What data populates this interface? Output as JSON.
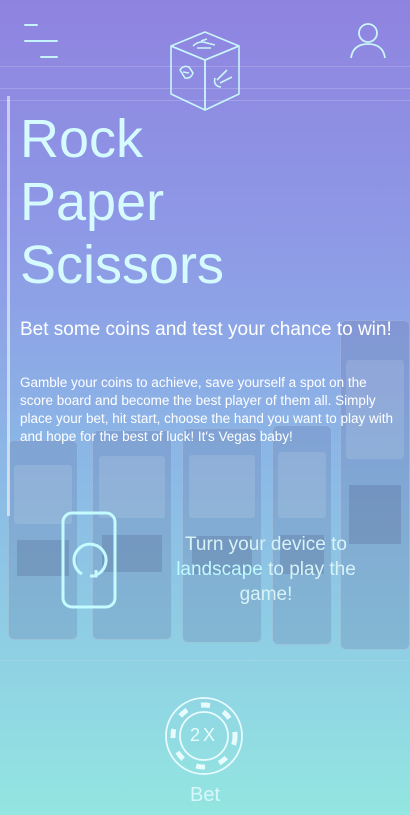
{
  "header": {
    "menu_icon": "hamburger-menu-icon",
    "logo_icon": "rps-dice-logo-icon",
    "user_icon": "user-profile-icon"
  },
  "hero": {
    "title_line1": "Rock",
    "title_line2": "Paper",
    "title_line3": "Scissors",
    "subtitle": "Bet some coins and test your chance to win!",
    "description": "Gamble your coins to achieve, save yourself a spot on the score board and become the best player of them all. Simply place your bet, hit start, choose the hand you want to play with and hope for the best of luck! It's Vegas baby!"
  },
  "rotate_notice": {
    "icon": "rotate-device-icon",
    "text_before": "Turn your device to",
    "highlight": "landscape",
    "text_after": "to play the game!"
  },
  "bet": {
    "chip_label": "2X",
    "label": "Bet",
    "icon": "poker-chip-icon"
  },
  "colors": {
    "gradient_top": "#8f83e0",
    "gradient_bottom": "#93e6e1",
    "title_color": "#d6fbff",
    "accent_cyan": "#bffaff"
  }
}
